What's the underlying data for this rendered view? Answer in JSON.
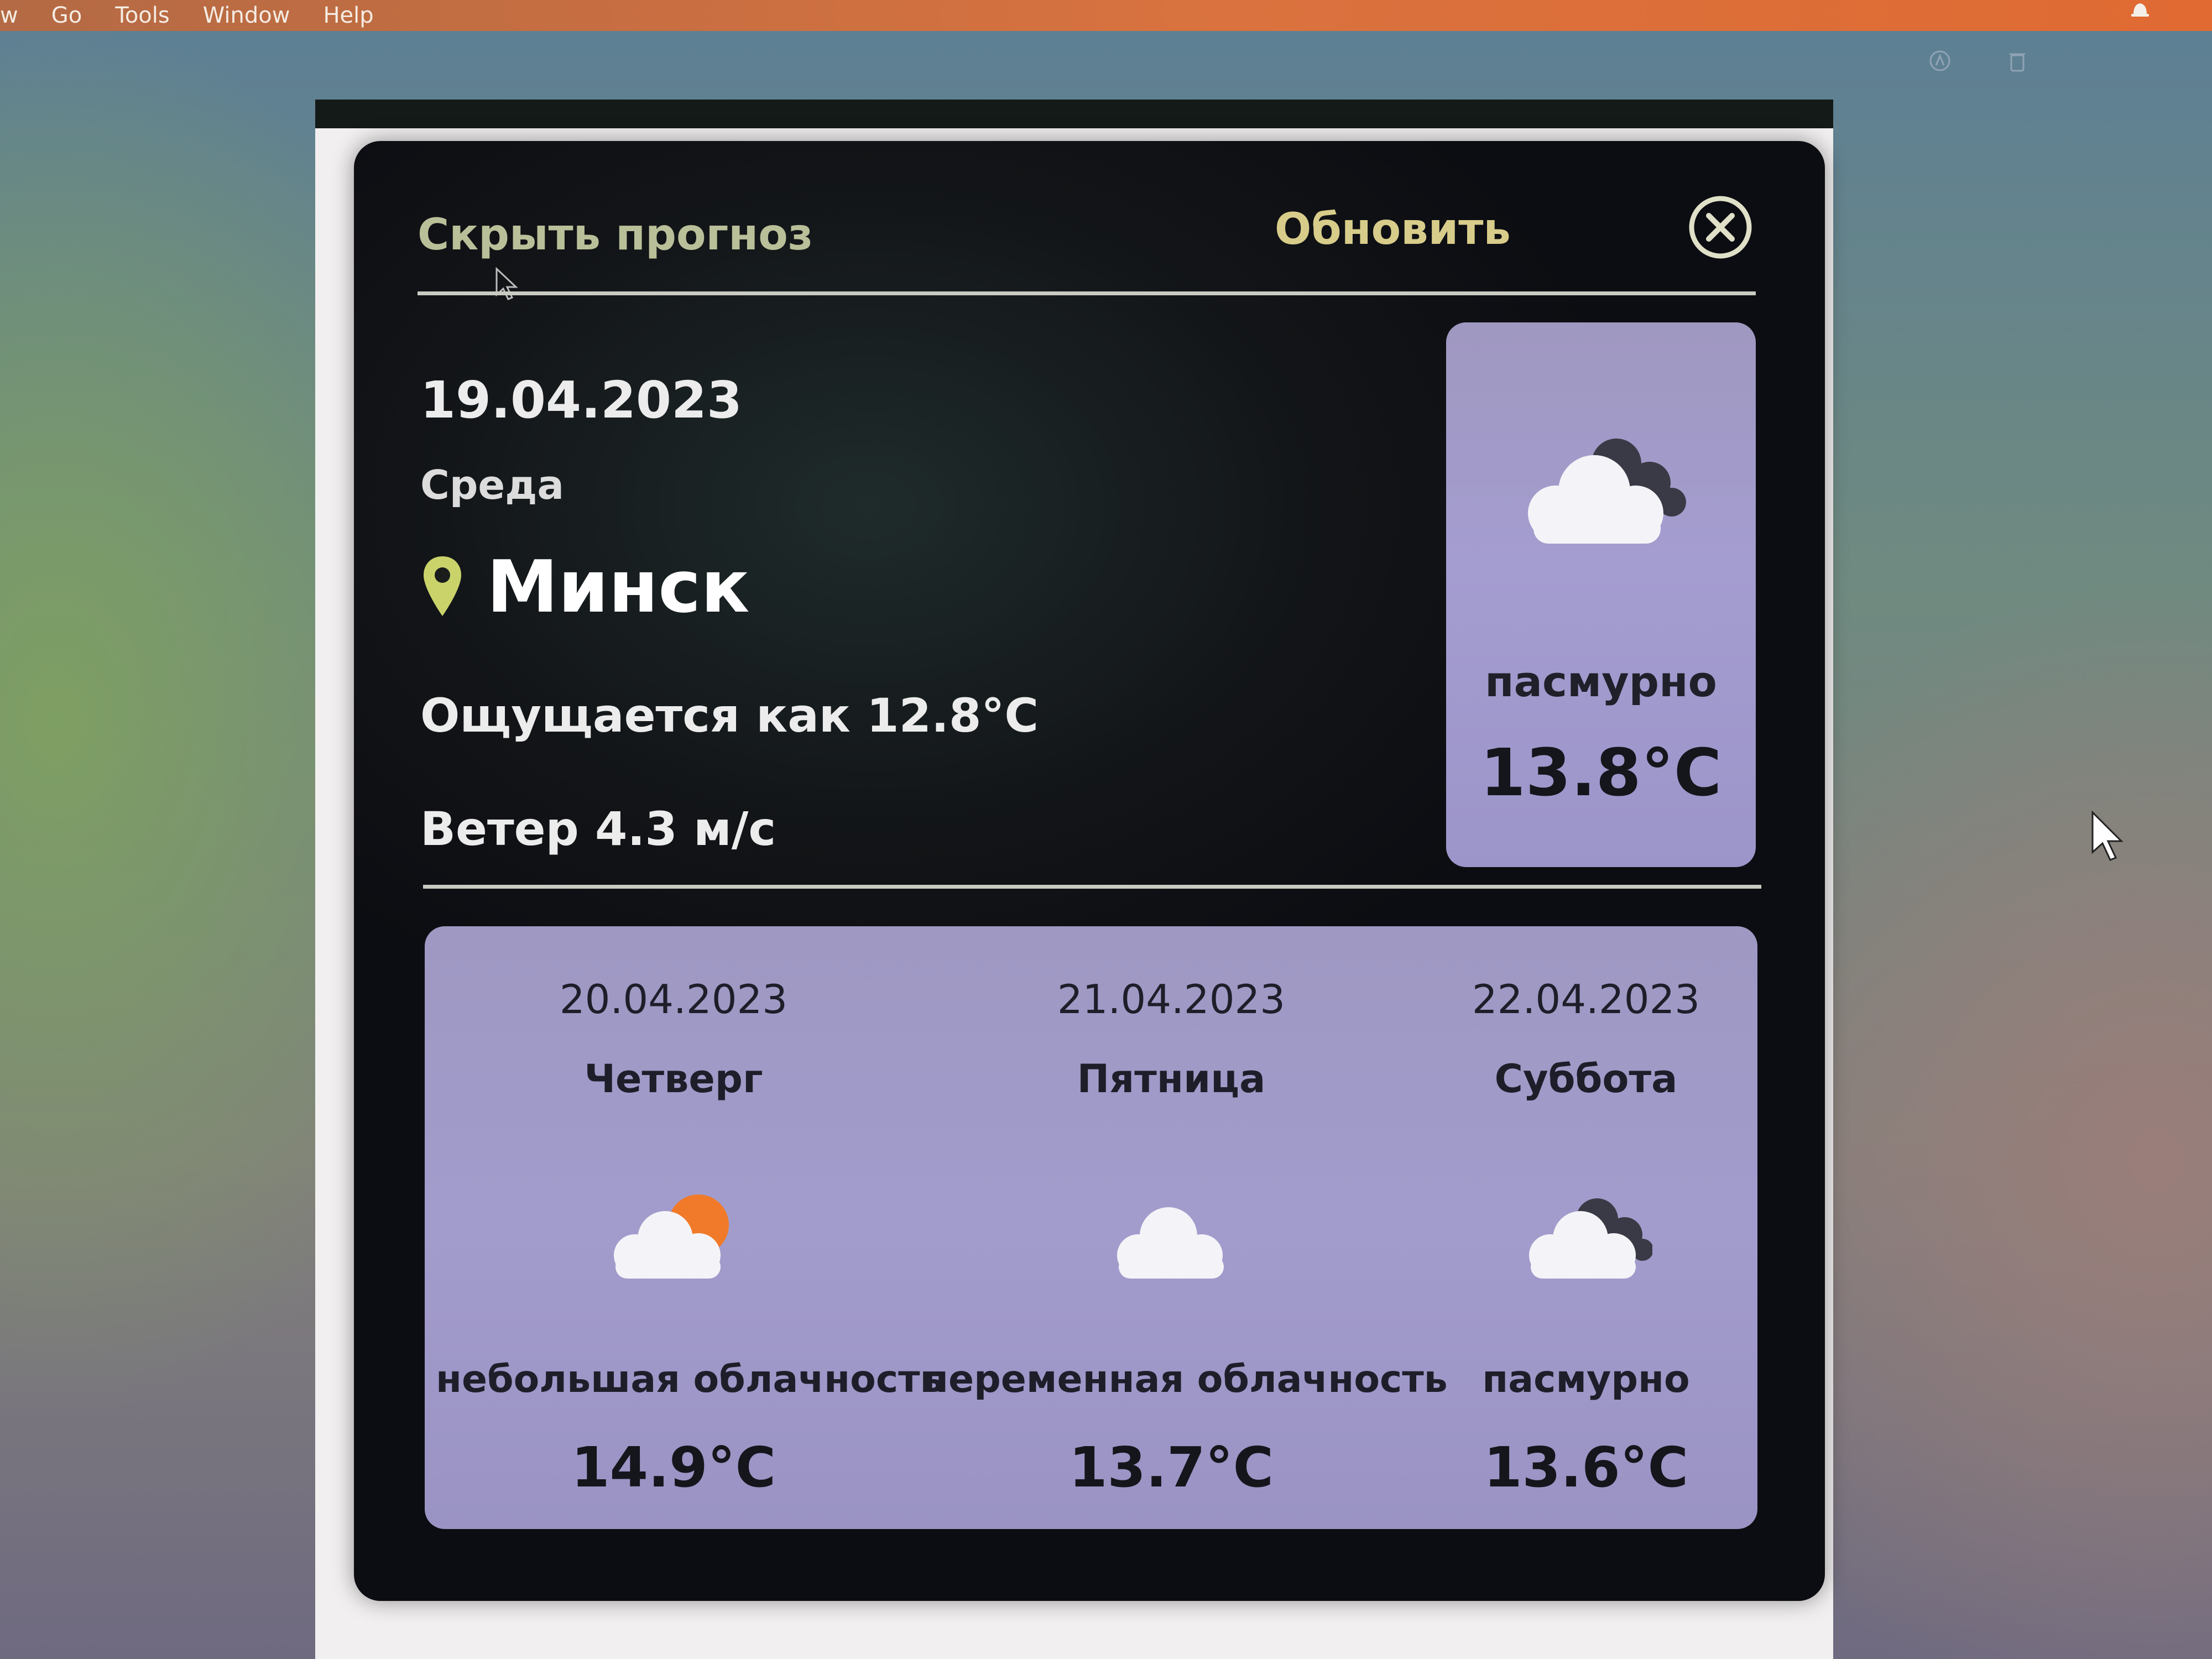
{
  "menubar": {
    "items": [
      "w",
      "Go",
      "Tools",
      "Window",
      "Help"
    ]
  },
  "widget": {
    "hide_forecast_label": "Скрыть прогноз",
    "refresh_label": "Обновить",
    "close_icon": "close-circle-icon",
    "current": {
      "date": "19.04.2023",
      "weekday": "Среда",
      "city": "Минск",
      "feels_like": "Ощущается как 12.8°C",
      "wind": "Ветер 4.3 м/с",
      "condition": "пасмурно",
      "temperature": "13.8°C",
      "icon": "overcast-cloud-icon"
    },
    "forecast": [
      {
        "date": "20.04.2023",
        "weekday": "Четверг",
        "condition": "небольшая облачность",
        "temperature": "14.9°C",
        "icon": "partly-cloudy-sun-icon"
      },
      {
        "date": "21.04.2023",
        "weekday": "Пятница",
        "condition": "переменная облачность",
        "temperature": "13.7°C",
        "icon": "cloud-icon"
      },
      {
        "date": "22.04.2023",
        "weekday": "Суббота",
        "condition": "пасмурно",
        "temperature": "13.6°C",
        "icon": "overcast-cloud-icon"
      }
    ]
  },
  "colors": {
    "widget_bg": "#121417",
    "card_bg": "#a29ccd",
    "hide_label": "#b9bf98",
    "refresh_label": "#d7cc8a",
    "pin": "#c9d36a",
    "menubar": "#d9723f"
  }
}
